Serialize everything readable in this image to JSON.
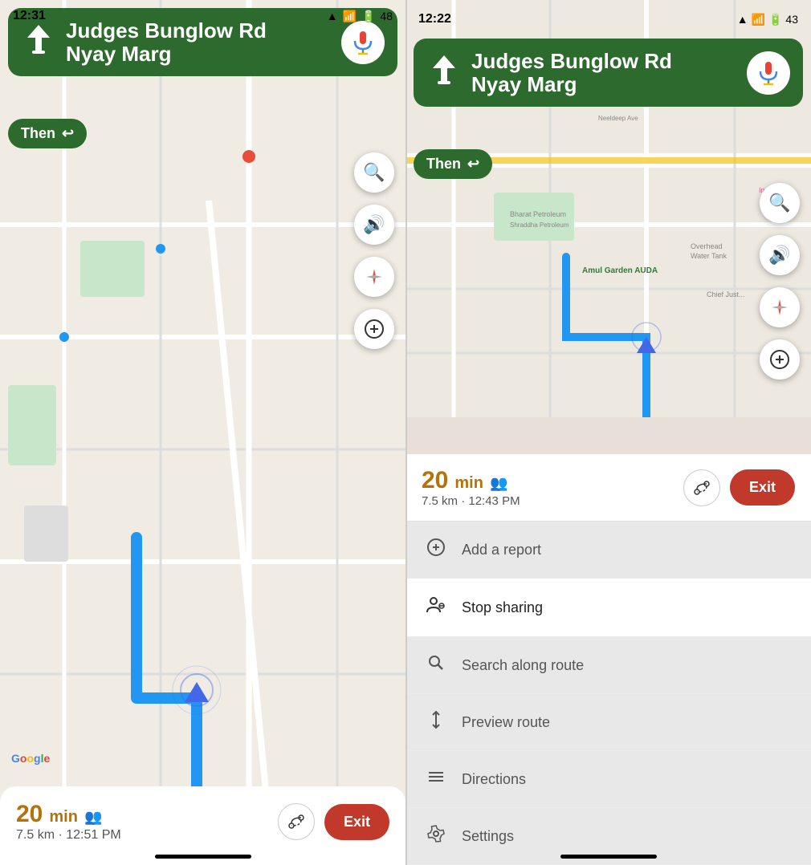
{
  "left": {
    "status": {
      "time": "12:31",
      "battery": "48"
    },
    "nav": {
      "street1": "Judges Bunglow Rd",
      "street2": "Nyay Marg",
      "then_label": "Then",
      "arrow_symbol": "↩"
    },
    "buttons": {
      "search": "🔍",
      "sound": "🔊",
      "compass": "◉",
      "chat": "💬"
    },
    "eta": {
      "minutes": "20",
      "unit": "min",
      "distance": "7.5 km",
      "arrival": "12:51 PM"
    },
    "actions": {
      "exit_label": "Exit"
    },
    "google_logo": "Google"
  },
  "right": {
    "status": {
      "time": "12:22",
      "battery": "43"
    },
    "nav": {
      "street1": "Judges Bunglow Rd",
      "street2": "Nyay Marg",
      "then_label": "Then",
      "arrow_symbol": "↩"
    },
    "eta": {
      "minutes": "20",
      "unit": "min",
      "distance": "7.5 km",
      "arrival": "12:43 PM"
    },
    "actions": {
      "exit_label": "Exit"
    },
    "menu": [
      {
        "id": "add-report",
        "icon": "💬+",
        "label": "Add a report",
        "highlight": false
      },
      {
        "id": "stop-sharing",
        "icon": "👤🔊",
        "label": "Stop sharing",
        "highlight": true
      },
      {
        "id": "search-route",
        "icon": "🔍",
        "label": "Search along route",
        "highlight": false
      },
      {
        "id": "preview-route",
        "icon": "↕",
        "label": "Preview route",
        "highlight": false
      },
      {
        "id": "directions",
        "icon": "≡",
        "label": "Directions",
        "highlight": false
      },
      {
        "id": "settings",
        "icon": "⚙",
        "label": "Settings",
        "highlight": false
      }
    ]
  }
}
